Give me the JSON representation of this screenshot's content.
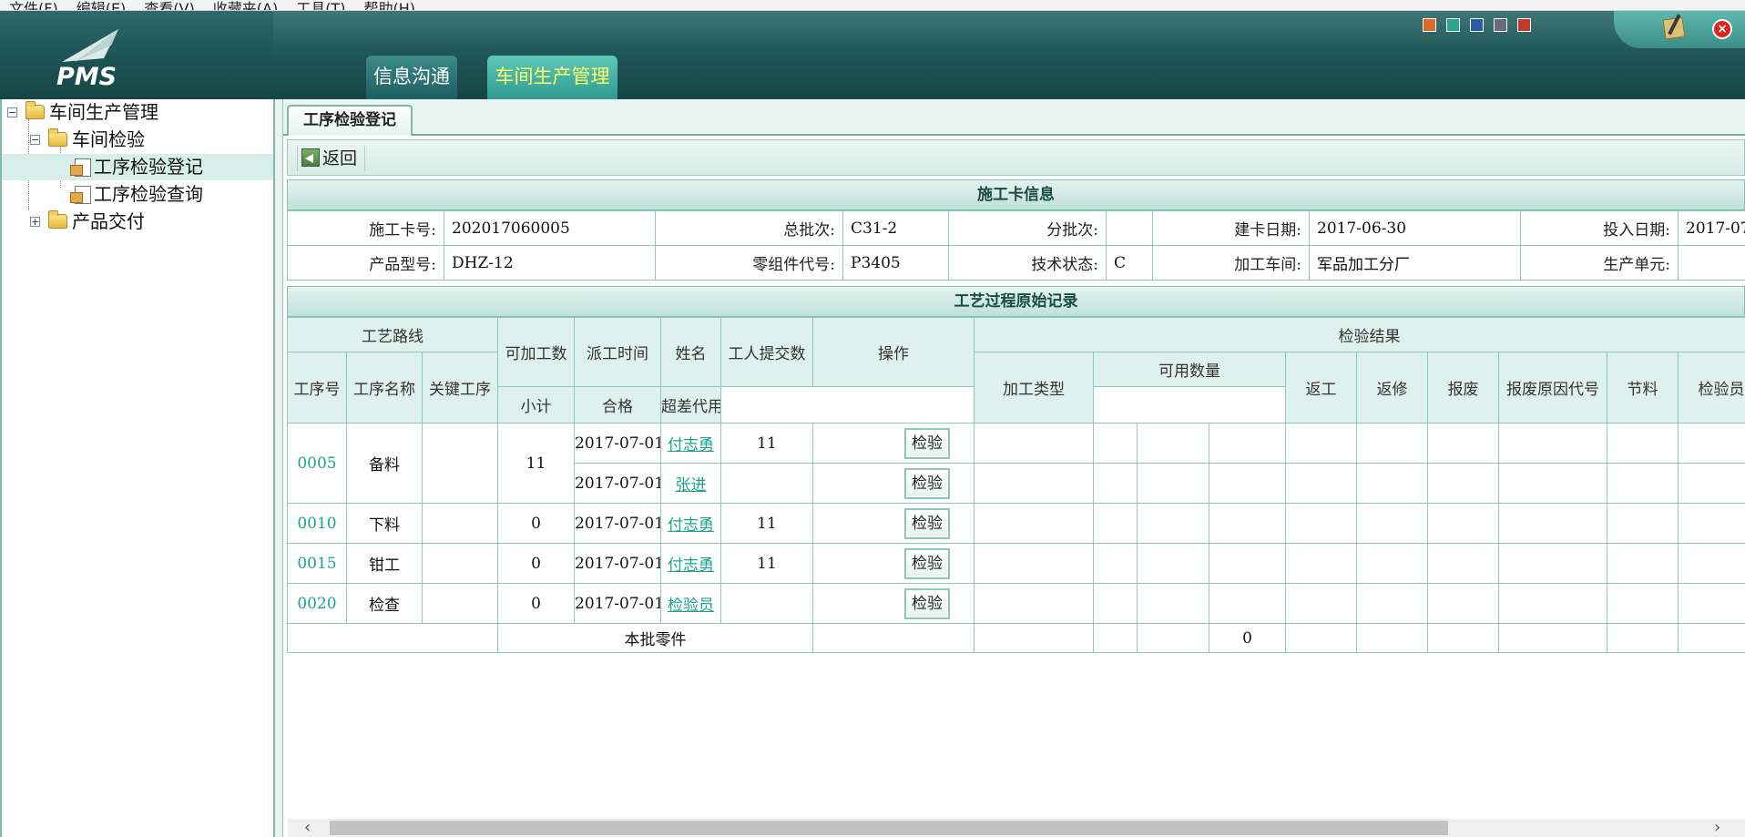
{
  "menubar": {
    "items": [
      "文件(F)",
      "编辑(E)",
      "查看(V)",
      "收藏夹(A)",
      "工具(T)",
      "帮助(H)"
    ]
  },
  "header": {
    "logo_text": "PMS",
    "nav_tabs": [
      "信息沟通",
      "车间生产管理"
    ],
    "active_nav": "车间生产管理",
    "theme_swatch_colors": [
      "#d96b2a",
      "#2aa58a",
      "#2d5aa8",
      "#6a6a7a",
      "#c0392b"
    ]
  },
  "sidebar": {
    "items": [
      {
        "label": "车间生产管理",
        "level": 0,
        "toggle": "−",
        "icon": "folder-open-icon"
      },
      {
        "label": "车间检验",
        "level": 1,
        "toggle": "−",
        "icon": "folder-open-icon"
      },
      {
        "label": "工序检验登记",
        "level": 2,
        "icon": "page-icon",
        "selected": true
      },
      {
        "label": "工序检验查询",
        "level": 2,
        "icon": "page-icon"
      },
      {
        "label": "产品交付",
        "level": 1,
        "toggle": "+",
        "icon": "folder-icon"
      }
    ]
  },
  "main": {
    "tab_label": "工序检验登记",
    "toolbar": {
      "back_label": "返回"
    },
    "card_info": {
      "title": "施工卡信息",
      "row1": [
        {
          "label": "施工卡号:",
          "value": "202017060005"
        },
        {
          "label": "总批次:",
          "value": "C31-2"
        },
        {
          "label": "分批次:",
          "value": ""
        },
        {
          "label": "建卡日期:",
          "value": "2017-06-30"
        },
        {
          "label": "投入日期:",
          "value": "2017-07"
        }
      ],
      "row2": [
        {
          "label": "产品型号:",
          "value": "DHZ-12"
        },
        {
          "label": "零组件代号:",
          "value": "P3405"
        },
        {
          "label": "技术状态:",
          "value": "C"
        },
        {
          "label": "加工车间:",
          "value": "军品加工分厂"
        },
        {
          "label": "生产单元:",
          "value": ""
        }
      ]
    },
    "process": {
      "title": "工艺过程原始记录",
      "group_route": "工艺路线",
      "group_result": "检验结果",
      "group_qty": "可用数量",
      "headers": {
        "op_no": "工序号",
        "op_name": "工序名称",
        "key_op": "关键工序",
        "workable": "可加工数",
        "dispatch_time": "派工时间",
        "name": "姓名",
        "submitted": "工人提交数",
        "action": "操作",
        "process_type": "加工类型",
        "subtotal": "小计",
        "qualified": "合格",
        "tolerance": "超差代用",
        "rework": "返工",
        "repair": "返修",
        "scrap": "报废",
        "scrap_code": "报废原因代号",
        "saving": "节料",
        "inspector": "检验员"
      },
      "rows": [
        {
          "op_no": "0005",
          "op_name": "备料",
          "workable": "11",
          "dispatch_time": "2017-07-01",
          "name": "付志勇",
          "submitted": "11",
          "button": "检验"
        },
        {
          "dispatch_time": "2017-07-01",
          "name": "张进",
          "submitted": "",
          "button": "检验"
        },
        {
          "op_no": "0010",
          "op_name": "下料",
          "workable": "0",
          "dispatch_time": "2017-07-01",
          "name": "付志勇",
          "submitted": "11",
          "button": "检验"
        },
        {
          "op_no": "0015",
          "op_name": "钳工",
          "workable": "0",
          "dispatch_time": "2017-07-01",
          "name": "付志勇",
          "submitted": "11",
          "button": "检验"
        },
        {
          "op_no": "0020",
          "op_name": "检查",
          "workable": "0",
          "dispatch_time": "2017-07-01",
          "name": "检验员",
          "submitted": "",
          "button": "检验"
        }
      ],
      "footer": {
        "label": "本批零件",
        "tolerance_total": "0"
      }
    }
  }
}
